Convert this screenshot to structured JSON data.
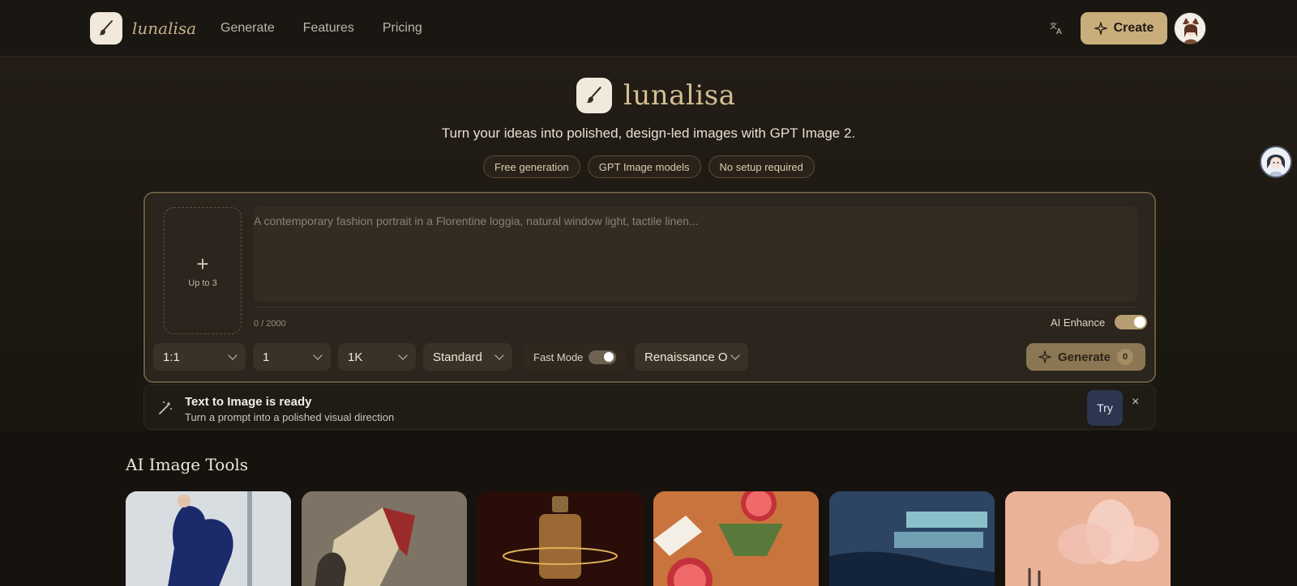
{
  "header": {
    "brand_name": "lunalisa",
    "nav": [
      "Generate",
      "Features",
      "Pricing"
    ],
    "create_label": "Create"
  },
  "hero": {
    "brand_name": "lunalisa",
    "tagline": "Turn your ideas into polished, design-led images with GPT Image 2.",
    "pills": [
      "Free generation",
      "GPT Image models",
      "No setup required"
    ]
  },
  "composer": {
    "upload_label": "Up to 3",
    "prompt_placeholder": "A contemporary fashion portrait in a Florentine loggia, natural window light, tactile linen...",
    "char_count": "0 / 2000",
    "enhance_label": "AI Enhance",
    "enhance_on": true,
    "aspect": "1:1",
    "count": "1",
    "resolution": "1K",
    "quality": "Standard",
    "fast_mode_label": "Fast Mode",
    "fast_mode_on": true,
    "style": "Renaissance O",
    "generate_label": "Generate",
    "generate_cost": "0"
  },
  "notice": {
    "title": "Text to Image is ready",
    "subtitle": "Turn a prompt into a polished visual direction",
    "try_label": "Try",
    "close_symbol": "×"
  },
  "tools": {
    "title": "AI Image Tools",
    "cards": [
      {
        "name": "fashion-dress-card"
      },
      {
        "name": "origami-sculpture-card"
      },
      {
        "name": "perfume-bottle-card"
      },
      {
        "name": "citrus-glass-card"
      },
      {
        "name": "coastal-architecture-card"
      },
      {
        "name": "crystal-flower-card"
      }
    ]
  },
  "colors": {
    "accent": "#c9ae7c",
    "background": "#16130f",
    "panel": "#2b251d"
  }
}
